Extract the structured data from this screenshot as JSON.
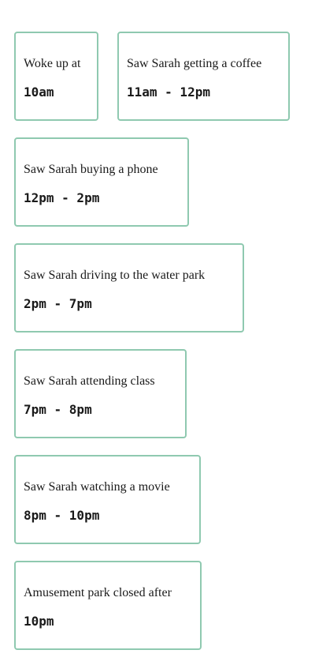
{
  "events": [
    {
      "label": "Woke up at",
      "time": "10am"
    },
    {
      "label": "Saw Sarah getting a coffee",
      "time": "11am - 12pm"
    },
    {
      "label": "Saw Sarah buying a phone",
      "time": "12pm - 2pm"
    },
    {
      "label": "Saw Sarah driving to the water park",
      "time": "2pm - 7pm"
    },
    {
      "label": "Saw Sarah attending class",
      "time": "7pm - 8pm"
    },
    {
      "label": "Saw Sarah watching a movie",
      "time": "8pm - 10pm"
    },
    {
      "label": "Amusement park closed after",
      "time": "10pm"
    }
  ],
  "colors": {
    "card_border": "#8fc9b0",
    "text": "#1a1a1a",
    "background": "#ffffff"
  }
}
